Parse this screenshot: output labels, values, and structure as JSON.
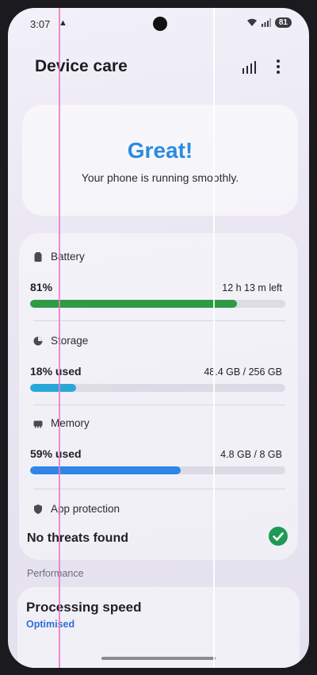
{
  "status_bar": {
    "time": "3:07",
    "notification": "▲",
    "battery_level": "81"
  },
  "header": {
    "title": "Device care"
  },
  "summary": {
    "headline": "Great!",
    "message": "Your phone is running smoothly."
  },
  "battery": {
    "label": "Battery",
    "value": "81%",
    "detail": "12 h 13 m left",
    "level": 0.81,
    "color": "#2e9a44"
  },
  "storage": {
    "label": "Storage",
    "value": "18% used",
    "detail": "48.4 GB / 256 GB",
    "level": 0.18,
    "color": "#29a8d8"
  },
  "memory": {
    "label": "Memory",
    "value": "59% used",
    "detail": "4.8 GB / 8 GB",
    "level": 0.59,
    "color": "#2f86e6"
  },
  "app_protection": {
    "label": "App protection",
    "status": "No threats found",
    "check_color": "#1f9a56"
  },
  "performance": {
    "section_label": "Performance",
    "title": "Processing speed",
    "status": "Optimised"
  }
}
